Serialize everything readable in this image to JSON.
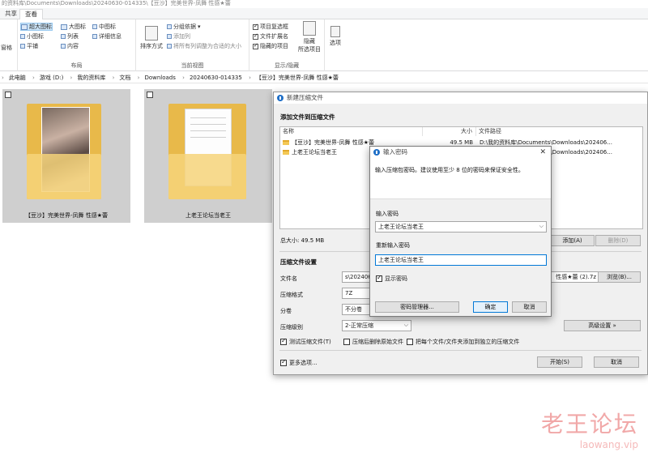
{
  "explorer": {
    "path_text": "的资料库\\Documents\\Downloads\\20240630-014335\\【豆沙】完美世界-凤舞 性感★蕾",
    "tabs": [
      "共享",
      "查看"
    ],
    "ribbon": {
      "layout_items": [
        "超大图标",
        "大图标",
        "中图标",
        "小图标",
        "列表",
        "详细信息",
        "平铺",
        "内容"
      ],
      "layout_left": "窗格",
      "layout_group": "布局",
      "sort_label": "排序方式",
      "view_items": [
        "分组依据",
        "添加列",
        "将所有列调整为合适的大小"
      ],
      "view_group": "当前视图",
      "show_items": [
        "项目复选框",
        "文件扩展名",
        "隐藏的项目"
      ],
      "hide_label": "隐藏",
      "selected_label": "所选项目",
      "options_label": "选项",
      "show_group": "显示/隐藏"
    },
    "breadcrumb": [
      "此电脑",
      "游戏 (D:)",
      "我的资料库",
      "文档",
      "Downloads",
      "20240630-014335",
      "【豆沙】完美世界-凤舞 性感★蕾"
    ],
    "tiles": [
      {
        "label": "【豆沙】完美世界-凤舞 性感★蕾"
      },
      {
        "label": "上老王论坛当老王"
      }
    ]
  },
  "compress_dialog": {
    "title": "新建压缩文件",
    "add_section": "添加文件到压缩文件",
    "columns": [
      "名称",
      "大小",
      "文件路径"
    ],
    "rows": [
      {
        "name": "【豆沙】完美世界-凤舞 性感★蕾",
        "size": "49.5 MB",
        "path": "D:\\我的资料库\\Documents\\Downloads\\202406..."
      },
      {
        "name": "上老王论坛当老王",
        "size": "",
        "path": "D:\\我的资料库\\Documents\\Downloads\\202406..."
      }
    ],
    "total_size": "总大小: 49.5 MB",
    "add_button": "添加(A)",
    "delete_button": "删除(D)",
    "settings_section": "压缩文件设置",
    "file_name_label": "文件名",
    "file_name_value_left": "s\\202406",
    "file_name_value_right": "性感★蕾 (2).7z",
    "browse_button": "浏览(B)...",
    "format_label": "压缩格式",
    "format_value": "7Z",
    "split_label": "分卷",
    "split_value": "不分卷",
    "level_label": "压缩级别",
    "level_value": "2-正常压缩",
    "advanced_button": "高级设置 »",
    "test_check": "测试压缩文件(T)",
    "delete_after_check": "压缩后删除原始文件",
    "each_file_check": "把每个文件/文件夹添加到独立的压缩文件",
    "more_options": "更多选项...",
    "start_button": "开始(S)",
    "cancel_button": "取消"
  },
  "password_dialog": {
    "title": "输入密码",
    "close": "✕",
    "instruction": "输入压缩包密码。建议使用至少 8 位的密码来保证安全性。",
    "enter_label": "输入密码",
    "enter_value": "上老王论坛当老王",
    "reenter_label": "重新输入密码",
    "reenter_value": "上老王论坛当老王",
    "show_password": "显示密码",
    "manager_button": "密码管理器...",
    "ok_button": "确定",
    "cancel_button": "取消"
  },
  "watermark": {
    "title": "老王论坛",
    "url": "laowang.vip"
  },
  "colors": {
    "accent": "#0078d7",
    "folder": "#f6d37a",
    "watermark": "#f1a8a8"
  }
}
